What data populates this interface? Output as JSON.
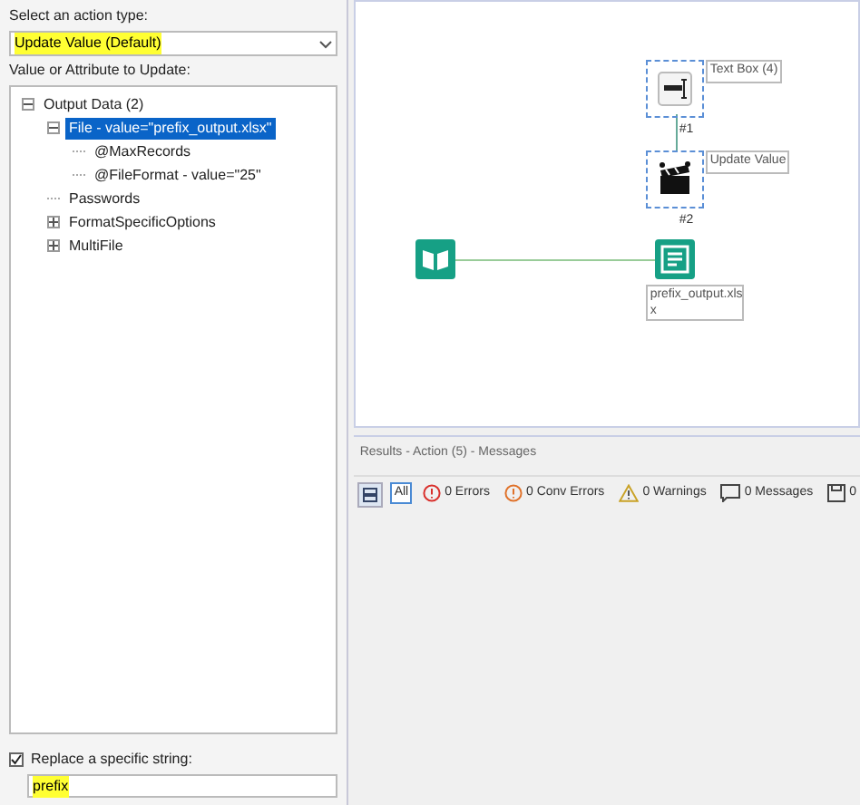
{
  "left_panel": {
    "action_type_label": "Select an action type:",
    "action_type": {
      "value": "Update Value (Default)",
      "highlighted": true
    },
    "tree_label": "Value or Attribute to Update:",
    "tree": [
      {
        "label": "Output Data (2)",
        "expanded": true,
        "selected": false,
        "children": [
          {
            "label": "File - value=\"prefix_output.xlsx\"",
            "expanded": true,
            "selected": true,
            "children": [
              {
                "label": "@MaxRecords",
                "selected": false
              },
              {
                "label": "@FileFormat - value=\"25\"",
                "selected": false
              }
            ]
          },
          {
            "label": "Passwords",
            "selected": false
          },
          {
            "label": "FormatSpecificOptions",
            "expanded": false,
            "selected": false
          },
          {
            "label": "MultiFile",
            "expanded": false,
            "selected": false
          }
        ]
      }
    ],
    "replace": {
      "label": "Replace a specific string:",
      "checked": true,
      "value": "prefix",
      "highlighted": true
    }
  },
  "canvas": {
    "nodes": [
      {
        "kind": "textbox",
        "label": "Text Box (4)",
        "number": "#1"
      },
      {
        "kind": "update",
        "label": "Update Value",
        "number": "#2"
      },
      {
        "kind": "input"
      },
      {
        "kind": "output",
        "label": "prefix_output.xls x"
      }
    ]
  },
  "results": {
    "title": "Results - Action (5) - Messages",
    "filters": [
      {
        "kind": "all",
        "label": "All",
        "selected": true
      },
      {
        "kind": "error",
        "label": "0 Errors",
        "selected": false
      },
      {
        "kind": "conv",
        "label": "0 Conv Errors",
        "selected": false
      },
      {
        "kind": "warning",
        "label": "0 Warnings",
        "selected": false
      },
      {
        "kind": "message",
        "label": "0 Messages",
        "selected": false
      },
      {
        "kind": "file",
        "label": "0",
        "selected": false
      }
    ]
  }
}
